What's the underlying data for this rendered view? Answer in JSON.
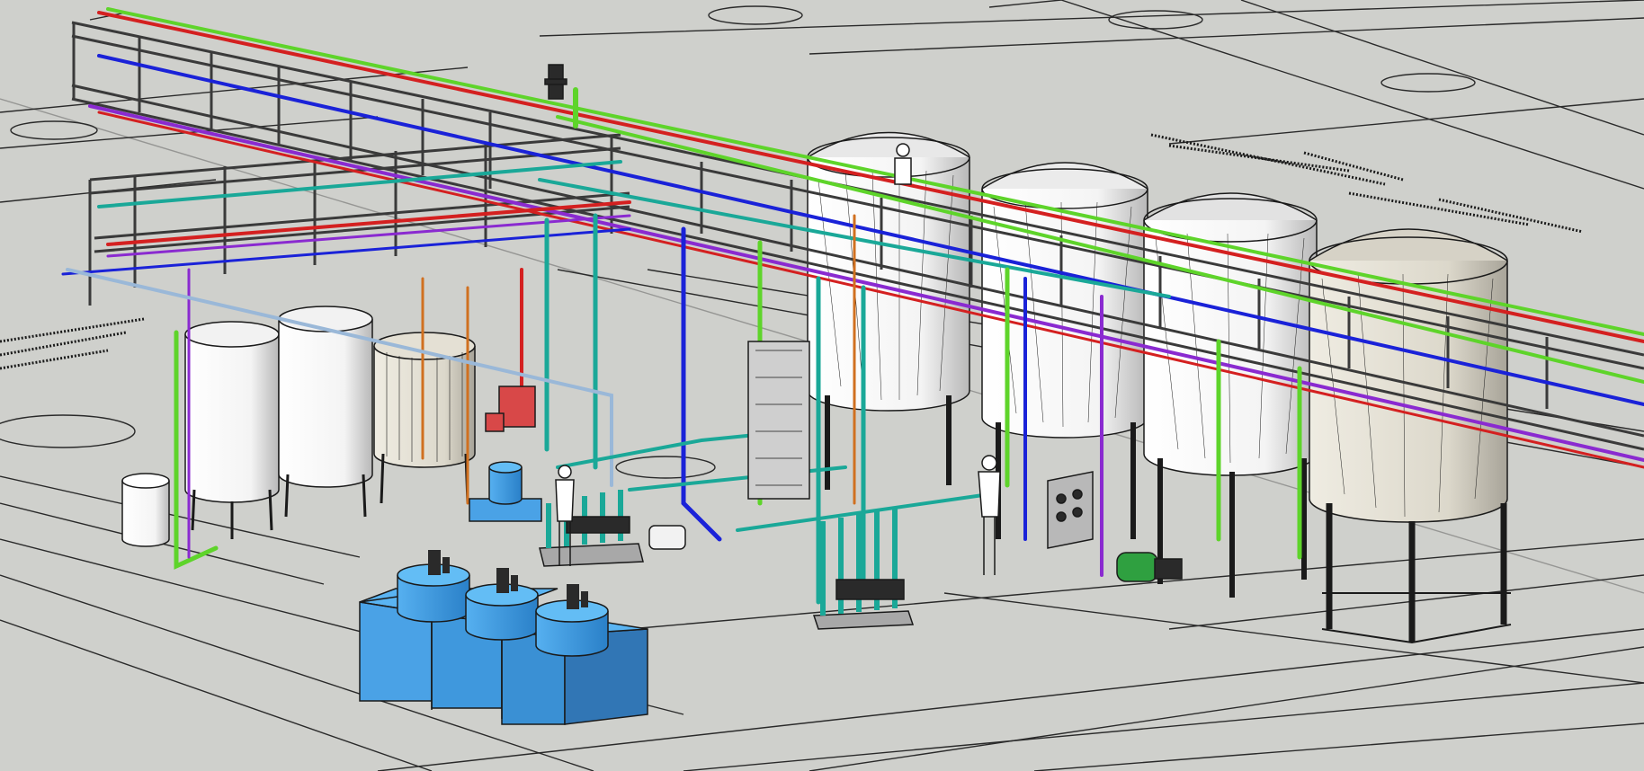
{
  "scene": {
    "background": "#cfd0cc",
    "colors": {
      "pipe_red": "#d42020",
      "pipe_green": "#5ed42a",
      "pipe_blue": "#1a22d8",
      "pipe_teal": "#1aa898",
      "pipe_purple": "#8a2ad0",
      "pipe_orange": "#d07020",
      "dosing_tank": "#3d9be0",
      "steel": "#8a8a8a",
      "tank_white": "#ffffff",
      "tank_beige": "#e0dcd0"
    },
    "icons": [
      "pipe-rack",
      "storage-tank",
      "dosing-tank",
      "pump",
      "heat-exchanger",
      "person"
    ]
  }
}
